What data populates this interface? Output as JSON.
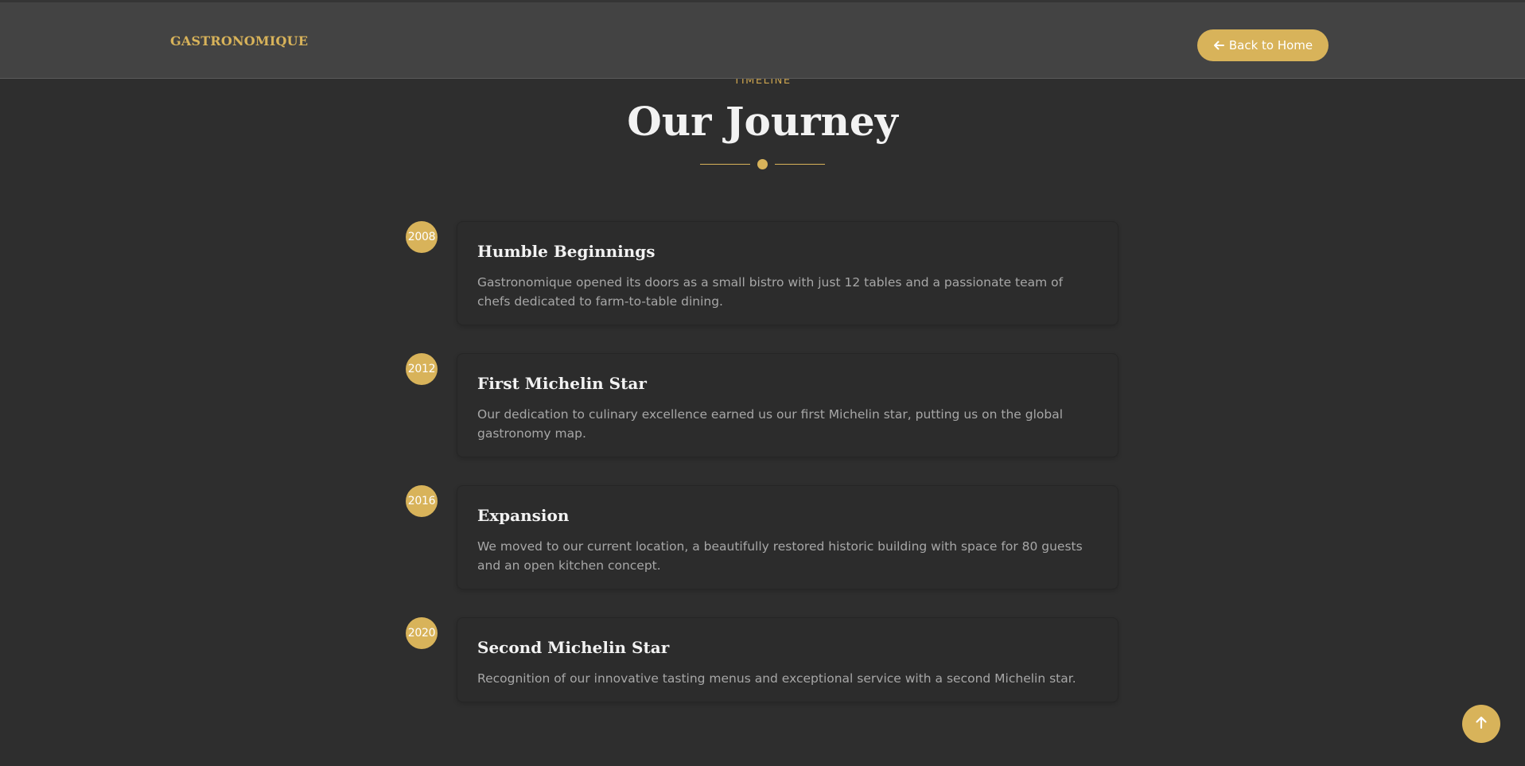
{
  "header": {
    "brand": "GASTRONOMIQUE",
    "back_button_label": "Back to Home",
    "back_icon": "arrow-left-icon"
  },
  "section": {
    "eyebrow": "TIMELINE",
    "title": "Our Journey"
  },
  "timeline": [
    {
      "year": "2008",
      "title": "Humble Beginnings",
      "text": "Gastronomique opened its doors as a small bistro with just 12 tables and a passionate team of chefs dedicated to farm-to-table dining."
    },
    {
      "year": "2012",
      "title": "First Michelin Star",
      "text": "Our dedication to culinary excellence earned us our first Michelin star, putting us on the global gastronomy map."
    },
    {
      "year": "2016",
      "title": "Expansion",
      "text": "We moved to our current location, a beautifully restored historic building with space for 80 guests and an open kitchen concept."
    },
    {
      "year": "2020",
      "title": "Second Michelin Star",
      "text": "Recognition of our innovative tasting menus and exceptional service with a second Michelin star."
    }
  ],
  "scroll_top_icon": "arrow-up-icon",
  "colors": {
    "accent": "#d8b35a",
    "background": "#2e2e2e",
    "header": "#434343",
    "card": "#2c2c2c",
    "heading": "#f2f2f2",
    "body_text": "#a7a7a7"
  }
}
